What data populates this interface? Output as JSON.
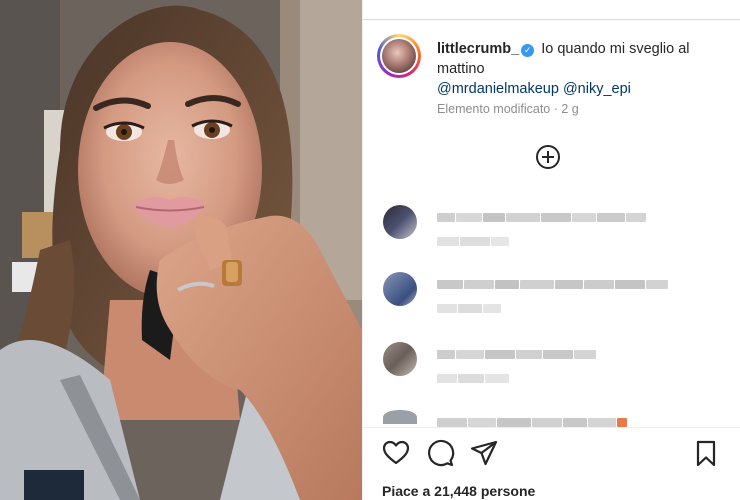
{
  "post": {
    "username": "littlecrumb_",
    "caption_text": "Io quando mi sveglio al mattino",
    "mentions": [
      "@mrdanielmakeup",
      "@niky_epi"
    ],
    "edited_label": "Elemento modificato",
    "time_ago": "2 g",
    "likes_text": "Piace a 21,448 persone"
  },
  "icons": {
    "verified": "verified-badge-icon",
    "load_more": "plus-circle-icon",
    "like": "heart-icon",
    "comment": "comment-icon",
    "share": "share-icon",
    "save": "bookmark-icon"
  },
  "colors": {
    "mention": "#00376b",
    "verified": "#3897f0",
    "meta": "#8e8e8e"
  }
}
